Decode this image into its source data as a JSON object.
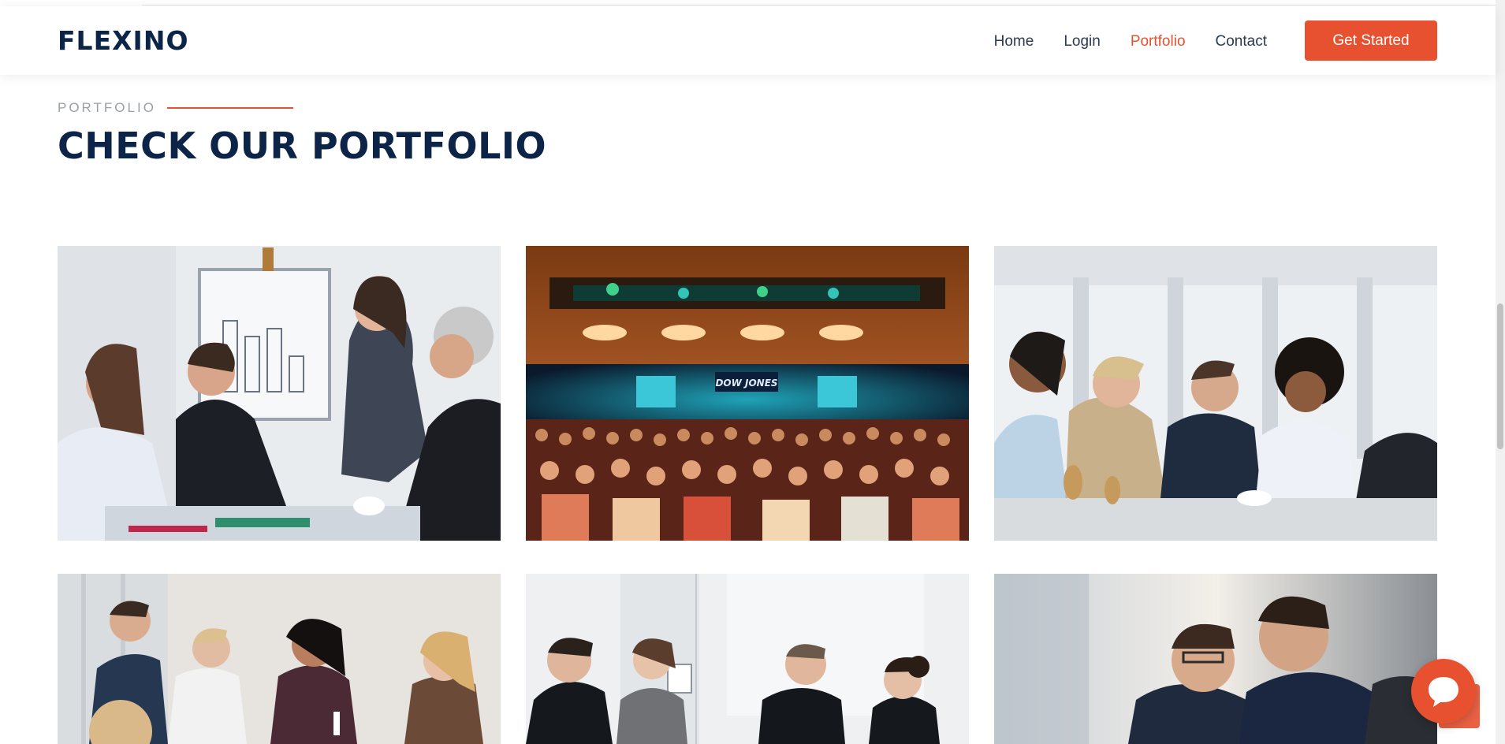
{
  "brand": {
    "name": "FLEXINO"
  },
  "nav": {
    "items": [
      {
        "label": "Home",
        "active": false
      },
      {
        "label": "Login",
        "active": false
      },
      {
        "label": "Portfolio",
        "active": true
      },
      {
        "label": "Contact",
        "active": false
      }
    ],
    "cta_label": "Get Started"
  },
  "section": {
    "eyebrow": "PORTFOLIO",
    "title": "CHECK OUR PORTFOLIO"
  },
  "colors": {
    "accent": "#e8512f",
    "navy": "#0b2447",
    "text": "#2b3a4f",
    "muted": "#9aa0a6"
  },
  "icons": {
    "chat": "chat-bubble-icon",
    "scroll_top": "arrow-up-icon"
  }
}
